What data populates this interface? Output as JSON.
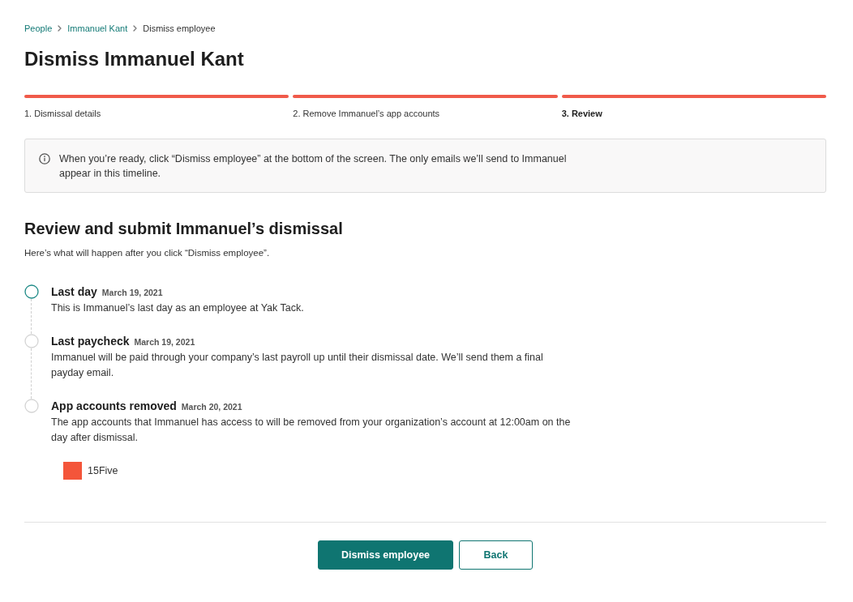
{
  "breadcrumb": [
    {
      "label": "People",
      "kind": "link"
    },
    {
      "label": "Immanuel Kant",
      "kind": "link"
    },
    {
      "label": "Dismiss employee",
      "kind": "current"
    }
  ],
  "title": "Dismiss Immanuel Kant",
  "steps": [
    {
      "label": "1. Dismissal details",
      "selected": false,
      "on": true
    },
    {
      "label": "2. Remove Immanuel’s app accounts",
      "selected": false,
      "on": true
    },
    {
      "label": "3. Review",
      "selected": true,
      "on": true
    }
  ],
  "notice": {
    "text": "When you’re ready, click “Dismiss employee” at the bottom of the screen. The only emails we’ll send to Immanuel appear in this timeline."
  },
  "review": {
    "heading": "Review and submit Immanuel’s dismissal",
    "intro": "Here’s what will happen after you click “Dismiss employee”."
  },
  "timeline": [
    {
      "title": "Last day",
      "date": "March 19, 2021",
      "description": "This is Immanuel’s last day as an employee at Yak Tack.",
      "active": true
    },
    {
      "title": "Last paycheck",
      "date": "March 19, 2021",
      "description": "Immanuel will be paid through your company’s last payroll up until their dismissal date. We’ll send them a final payday email.",
      "active": false
    },
    {
      "title": "App accounts removed",
      "date": "March 20, 2021",
      "description": "The app accounts that Immanuel has access to will be removed from your organization’s account at 12:00am on the day after dismissal.",
      "active": false,
      "apps": [
        {
          "name": "15Five",
          "color": "#f4553a"
        }
      ]
    }
  ],
  "buttons": [
    {
      "label": "Dismiss employee",
      "kind": "primary"
    },
    {
      "label": "Back",
      "kind": "secondary"
    }
  ]
}
